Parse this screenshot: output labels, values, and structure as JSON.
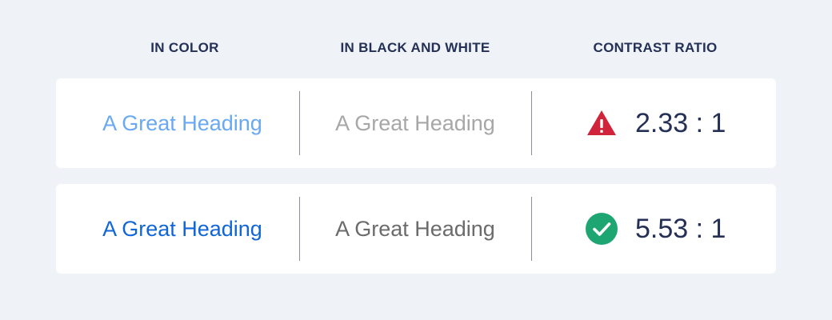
{
  "columns": {
    "color": "IN COLOR",
    "bw": "IN BLACK AND WHITE",
    "ratio": "CONTRAST RATIO"
  },
  "rows": [
    {
      "color_text": "A Great Heading",
      "color_hex": "#6aa9f2",
      "bw_text": "A Great Heading",
      "bw_hex": "#a7a7a7",
      "status_icon": "warning-icon",
      "status_color": "#d0243a",
      "ratio": "2.33 : 1"
    },
    {
      "color_text": "A Great Heading",
      "color_hex": "#1066d6",
      "bw_text": "A Great Heading",
      "bw_hex": "#6b6b6b",
      "status_icon": "check-icon",
      "status_color": "#1ea672",
      "ratio": "5.53 : 1"
    }
  ]
}
